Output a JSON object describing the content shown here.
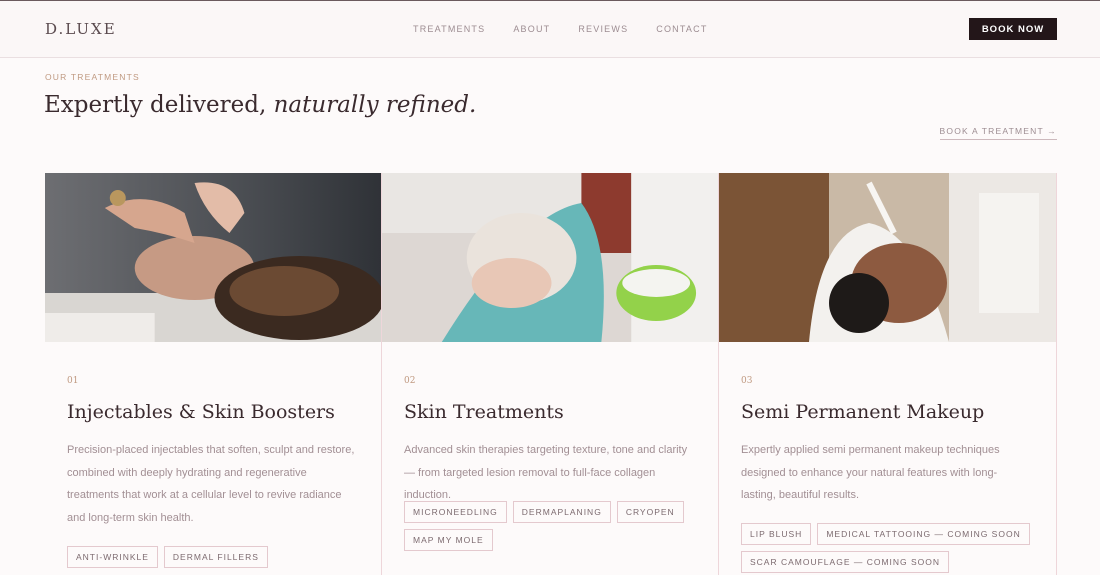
{
  "brand": {
    "logo": "D.LUXE"
  },
  "nav": {
    "items": [
      "TREATMENTS",
      "ABOUT",
      "REVIEWS",
      "CONTACT"
    ],
    "book_now": "BOOK NOW"
  },
  "section": {
    "eyebrow": "OUR TREATMENTS",
    "headline_plain": "Expertly delivered,",
    "headline_italic": "naturally refined.",
    "book_link": "BOOK A TREATMENT →"
  },
  "cards": [
    {
      "num": "01",
      "title": "Injectables & Skin Boosters",
      "desc": "Precision-placed injectables that soften, sculpt and restore, combined with deeply hydrating and regenerative treatments that work at a cellular level to revive radiance and long-term skin health.",
      "tags": [
        "ANTI-WRINKLE",
        "DERMAL FILLERS"
      ]
    },
    {
      "num": "02",
      "title": "Skin Treatments",
      "desc": "Advanced skin therapies targeting texture, tone and clarity — from targeted lesion removal to full-face collagen induction.",
      "tags": [
        "MICRONEEDLING",
        "DERMAPLANING",
        "CRYOPEN",
        "MAP MY MOLE"
      ]
    },
    {
      "num": "03",
      "title": "Semi Permanent Makeup",
      "desc": "Expertly applied semi permanent makeup techniques designed to enhance your natural features with long-lasting, beautiful results.",
      "tags": [
        "LIP BLUSH",
        "MEDICAL TATTOOING — COMING SOON",
        "SCAR CAMOUFLAGE — COMING SOON"
      ]
    }
  ],
  "colors": {
    "accent": "#c09a82",
    "dark": "#231619",
    "tag_border": "#e4c9ce"
  }
}
